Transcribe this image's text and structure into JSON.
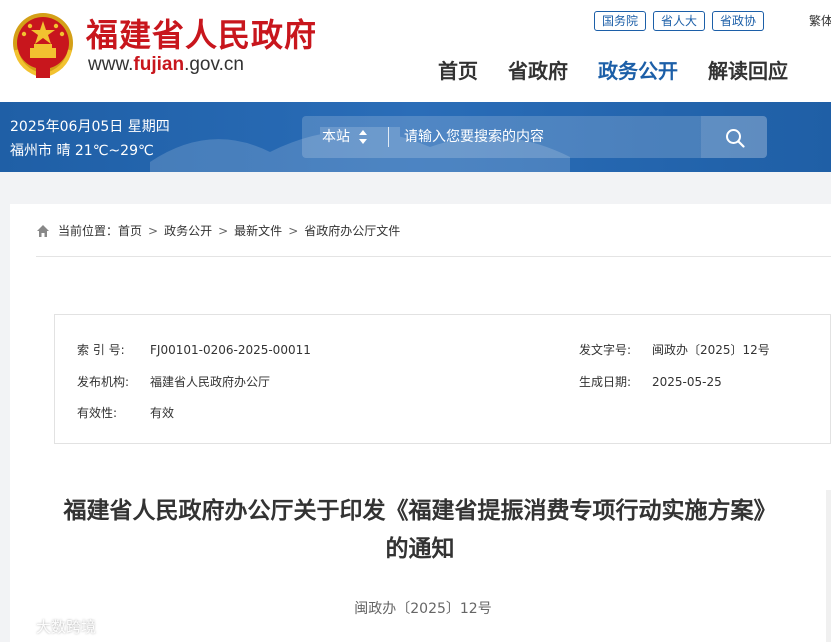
{
  "header": {
    "site_title": "福建省人民政府",
    "url_prefix": "www.",
    "url_domain": "fujian",
    "url_suffix": ".gov.cn",
    "top_links": [
      "国务院",
      "省人大",
      "省政协"
    ],
    "lang_toggle": "繁体",
    "nav": [
      "首页",
      "省政府",
      "政务公开",
      "解读回应"
    ],
    "nav_active_index": 2
  },
  "band": {
    "date": "2025年06月05日 星期四",
    "weather": "福州市 晴 21℃~29℃",
    "search_scope": "本站",
    "search_placeholder": "请输入您要搜索的内容"
  },
  "breadcrumb": {
    "prefix": "当前位置：",
    "items": [
      "首页",
      "政务公开",
      "最新文件",
      "省政府办公厅文件"
    ]
  },
  "meta": {
    "index_label": "索 引 号:",
    "index_value": "FJ00101-0206-2025-00011",
    "doc_no_label": "发文字号:",
    "doc_no_value": "闽政办〔2025〕12号",
    "publisher_label": "发布机构:",
    "publisher_value": "福建省人民政府办公厅",
    "date_label": "生成日期:",
    "date_value": "2025-05-25",
    "validity_label": "有效性:",
    "validity_value": "有效"
  },
  "document": {
    "title": "福建省人民政府办公厅关于印发《福建省提振消费专项行动实施方案》的通知",
    "number": "闽政办〔2025〕12号"
  },
  "watermark": "大数跨境",
  "colors": {
    "brand_red": "#c8161d",
    "brand_blue": "#1c5fa8",
    "band_blue": "#2366b0"
  }
}
